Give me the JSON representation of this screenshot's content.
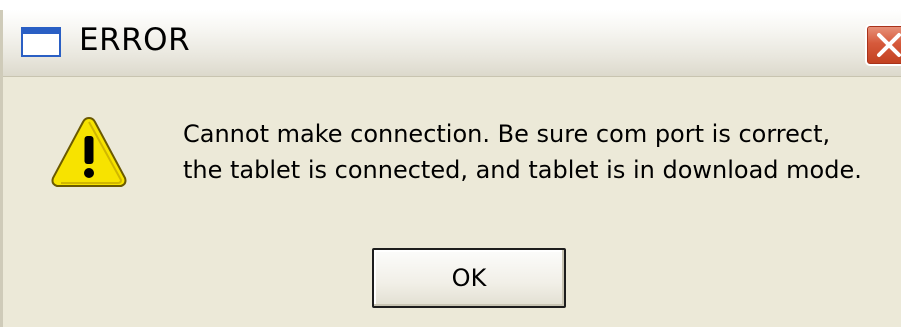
{
  "window": {
    "title": "ERROR",
    "icon": "window-icon",
    "close_icon": "close-icon"
  },
  "dialog": {
    "icon": "warning-icon",
    "message_lines": [
      "Cannot make connection. Be sure com port is correct,",
      "the tablet is connected, and tablet is in download mode."
    ],
    "ok_label": "OK"
  },
  "colors": {
    "dialog_bg": "#ece9d8",
    "close_button": "#d65a3c",
    "warning_fill": "#f7e300",
    "icon_border": "#2a5fc4"
  }
}
